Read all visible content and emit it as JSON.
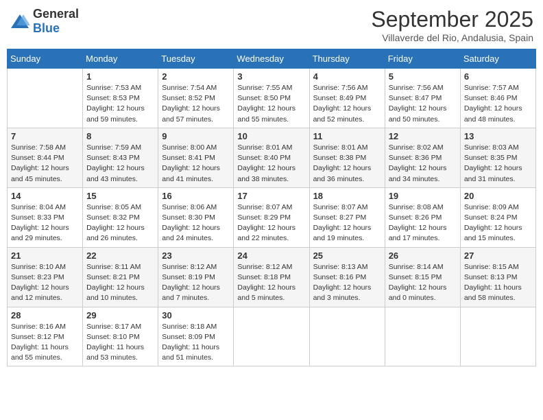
{
  "header": {
    "logo_general": "General",
    "logo_blue": "Blue",
    "month_title": "September 2025",
    "subtitle": "Villaverde del Rio, Andalusia, Spain"
  },
  "days_of_week": [
    "Sunday",
    "Monday",
    "Tuesday",
    "Wednesday",
    "Thursday",
    "Friday",
    "Saturday"
  ],
  "weeks": [
    [
      {
        "day": "",
        "content": ""
      },
      {
        "day": "1",
        "content": "Sunrise: 7:53 AM\nSunset: 8:53 PM\nDaylight: 12 hours\nand 59 minutes."
      },
      {
        "day": "2",
        "content": "Sunrise: 7:54 AM\nSunset: 8:52 PM\nDaylight: 12 hours\nand 57 minutes."
      },
      {
        "day": "3",
        "content": "Sunrise: 7:55 AM\nSunset: 8:50 PM\nDaylight: 12 hours\nand 55 minutes."
      },
      {
        "day": "4",
        "content": "Sunrise: 7:56 AM\nSunset: 8:49 PM\nDaylight: 12 hours\nand 52 minutes."
      },
      {
        "day": "5",
        "content": "Sunrise: 7:56 AM\nSunset: 8:47 PM\nDaylight: 12 hours\nand 50 minutes."
      },
      {
        "day": "6",
        "content": "Sunrise: 7:57 AM\nSunset: 8:46 PM\nDaylight: 12 hours\nand 48 minutes."
      }
    ],
    [
      {
        "day": "7",
        "content": "Sunrise: 7:58 AM\nSunset: 8:44 PM\nDaylight: 12 hours\nand 45 minutes."
      },
      {
        "day": "8",
        "content": "Sunrise: 7:59 AM\nSunset: 8:43 PM\nDaylight: 12 hours\nand 43 minutes."
      },
      {
        "day": "9",
        "content": "Sunrise: 8:00 AM\nSunset: 8:41 PM\nDaylight: 12 hours\nand 41 minutes."
      },
      {
        "day": "10",
        "content": "Sunrise: 8:01 AM\nSunset: 8:40 PM\nDaylight: 12 hours\nand 38 minutes."
      },
      {
        "day": "11",
        "content": "Sunrise: 8:01 AM\nSunset: 8:38 PM\nDaylight: 12 hours\nand 36 minutes."
      },
      {
        "day": "12",
        "content": "Sunrise: 8:02 AM\nSunset: 8:36 PM\nDaylight: 12 hours\nand 34 minutes."
      },
      {
        "day": "13",
        "content": "Sunrise: 8:03 AM\nSunset: 8:35 PM\nDaylight: 12 hours\nand 31 minutes."
      }
    ],
    [
      {
        "day": "14",
        "content": "Sunrise: 8:04 AM\nSunset: 8:33 PM\nDaylight: 12 hours\nand 29 minutes."
      },
      {
        "day": "15",
        "content": "Sunrise: 8:05 AM\nSunset: 8:32 PM\nDaylight: 12 hours\nand 26 minutes."
      },
      {
        "day": "16",
        "content": "Sunrise: 8:06 AM\nSunset: 8:30 PM\nDaylight: 12 hours\nand 24 minutes."
      },
      {
        "day": "17",
        "content": "Sunrise: 8:07 AM\nSunset: 8:29 PM\nDaylight: 12 hours\nand 22 minutes."
      },
      {
        "day": "18",
        "content": "Sunrise: 8:07 AM\nSunset: 8:27 PM\nDaylight: 12 hours\nand 19 minutes."
      },
      {
        "day": "19",
        "content": "Sunrise: 8:08 AM\nSunset: 8:26 PM\nDaylight: 12 hours\nand 17 minutes."
      },
      {
        "day": "20",
        "content": "Sunrise: 8:09 AM\nSunset: 8:24 PM\nDaylight: 12 hours\nand 15 minutes."
      }
    ],
    [
      {
        "day": "21",
        "content": "Sunrise: 8:10 AM\nSunset: 8:23 PM\nDaylight: 12 hours\nand 12 minutes."
      },
      {
        "day": "22",
        "content": "Sunrise: 8:11 AM\nSunset: 8:21 PM\nDaylight: 12 hours\nand 10 minutes."
      },
      {
        "day": "23",
        "content": "Sunrise: 8:12 AM\nSunset: 8:19 PM\nDaylight: 12 hours\nand 7 minutes."
      },
      {
        "day": "24",
        "content": "Sunrise: 8:12 AM\nSunset: 8:18 PM\nDaylight: 12 hours\nand 5 minutes."
      },
      {
        "day": "25",
        "content": "Sunrise: 8:13 AM\nSunset: 8:16 PM\nDaylight: 12 hours\nand 3 minutes."
      },
      {
        "day": "26",
        "content": "Sunrise: 8:14 AM\nSunset: 8:15 PM\nDaylight: 12 hours\nand 0 minutes."
      },
      {
        "day": "27",
        "content": "Sunrise: 8:15 AM\nSunset: 8:13 PM\nDaylight: 11 hours\nand 58 minutes."
      }
    ],
    [
      {
        "day": "28",
        "content": "Sunrise: 8:16 AM\nSunset: 8:12 PM\nDaylight: 11 hours\nand 55 minutes."
      },
      {
        "day": "29",
        "content": "Sunrise: 8:17 AM\nSunset: 8:10 PM\nDaylight: 11 hours\nand 53 minutes."
      },
      {
        "day": "30",
        "content": "Sunrise: 8:18 AM\nSunset: 8:09 PM\nDaylight: 11 hours\nand 51 minutes."
      },
      {
        "day": "",
        "content": ""
      },
      {
        "day": "",
        "content": ""
      },
      {
        "day": "",
        "content": ""
      },
      {
        "day": "",
        "content": ""
      }
    ]
  ]
}
